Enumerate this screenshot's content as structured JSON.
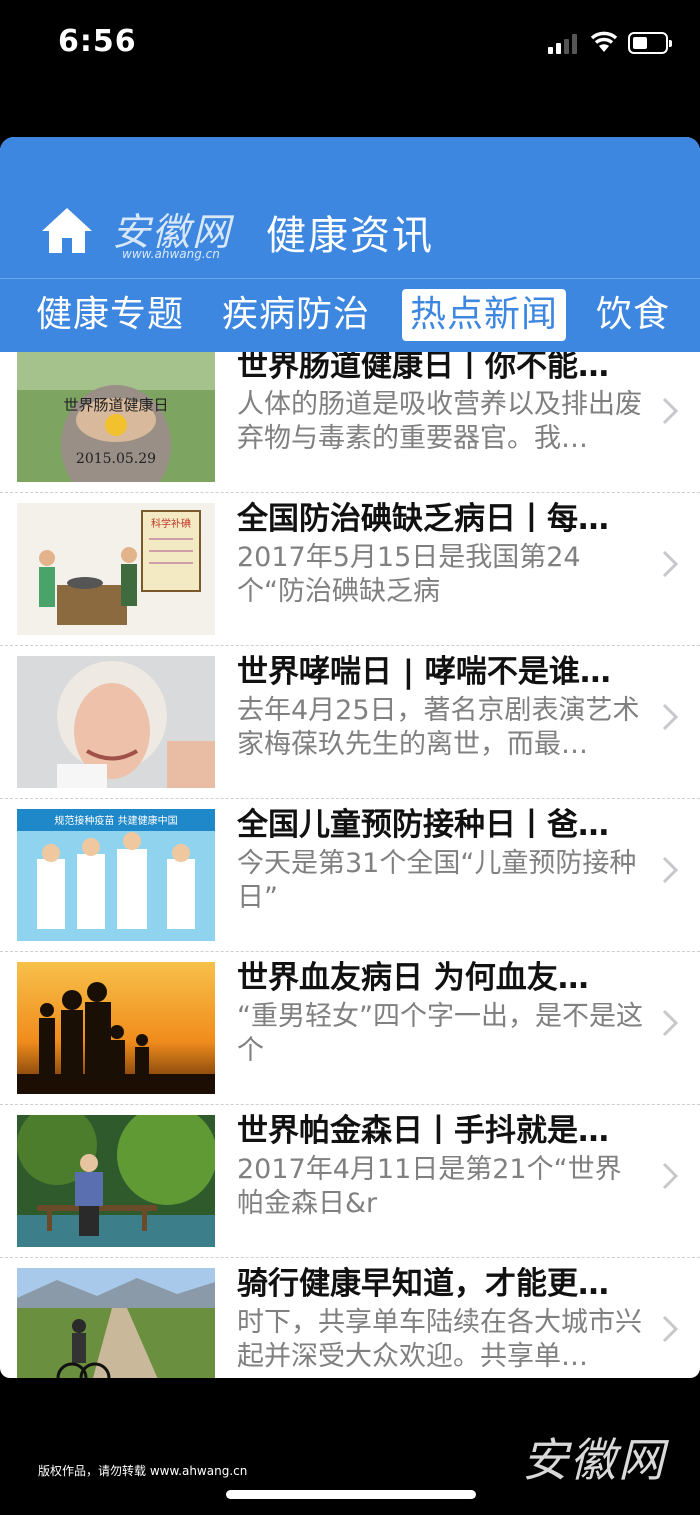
{
  "status_bar": {
    "time": "6:56"
  },
  "header": {
    "logo_text": "安徽网",
    "logo_url": "www.ahwang.cn",
    "title": "健康资讯"
  },
  "tabs": [
    {
      "label": "健康专题",
      "active": false
    },
    {
      "label": "疾病防治",
      "active": false
    },
    {
      "label": "热点新闻",
      "active": true
    },
    {
      "label": "饮食",
      "active": false
    }
  ],
  "articles": [
    {
      "title": "世界肠道健康日丨你不能…",
      "desc": "人体的肠道是吸收营养以及排出废弃物与毒素的重要器官。我…",
      "thumb_text": [
        "世界肠道健康日",
        "2015.05.29"
      ]
    },
    {
      "title": "全国防治碘缺乏病日丨每…",
      "desc": "2017年5月15日是我国第24个“防治碘缺乏病",
      "thumb_text": [
        "科学补碘"
      ]
    },
    {
      "title": "世界哮喘日 | 哮喘不是谁…",
      "desc": "去年4月25日，著名京剧表演艺术家梅葆玖先生的离世，而最…",
      "thumb_text": []
    },
    {
      "title": "全国儿童预防接种日丨爸…",
      "desc": "今天是第31个全国“儿童预防接种日”",
      "thumb_text": [
        "规范接种疫苗 共建健康中国"
      ]
    },
    {
      "title": "世界血友病日 为何血友…",
      "desc": "“重男轻女”四个字一出，是不是这个",
      "thumb_text": []
    },
    {
      "title": "世界帕金森日丨手抖就是…",
      "desc": "2017年4月11日是第21个“世界帕金森日&r",
      "thumb_text": []
    },
    {
      "title": "骑行健康早知道，才能更…",
      "desc": "时下，共享单车陆续在各大城市兴起并深受大众欢迎。共享单…",
      "thumb_text": []
    }
  ],
  "footer": {
    "note": "版权作品，请勿转载 www.ahwang.cn",
    "logo_text": "安徽网"
  },
  "colors": {
    "accent": "#3d87e0",
    "title": "#111111",
    "desc": "#808080"
  }
}
